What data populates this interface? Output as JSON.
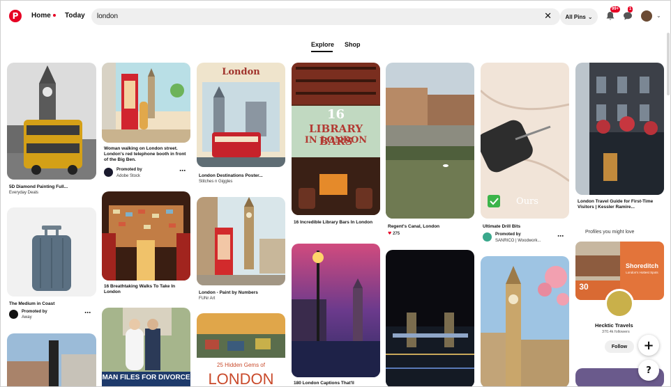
{
  "header": {
    "home_label": "Home",
    "today_label": "Today",
    "search_value": "london",
    "filter_label": "All Pins",
    "notifications_badge": "99+",
    "messages_badge": "1"
  },
  "tabs": {
    "explore": "Explore",
    "shop": "Shop"
  },
  "pins": {
    "p1": {
      "title": "5D Diamond Painting Full...",
      "source": "Everyday Deals"
    },
    "p2": {
      "title": "The Medium in Coast",
      "promoted": "Promoted by",
      "brand": "Away"
    },
    "p3": {
      "title": "Woman walking on London street. London's red telephone booth in front of the Big Ben.",
      "promoted": "Promoted by",
      "brand": "Adobe Stock"
    },
    "p4": {
      "title": "16 Breathtaking Walks To Take In London"
    },
    "p4b": {
      "overlay": "MAN FILES FOR DIVORCE"
    },
    "p5": {
      "overlay": "London",
      "title": "London Destinations Poster...",
      "source": "Stitches n Giggles"
    },
    "p6": {
      "title": "London - Paint by Numbers",
      "source": "FUNr Art"
    },
    "p6b": {
      "overlay_small": "25 Hidden Gems of",
      "overlay_big": "LONDON"
    },
    "p7": {
      "overlay_num": "16",
      "overlay_line1": "LIBRARY BARS",
      "overlay_line2": "IN LONDON",
      "title": "16 Incredible Library Bars In London"
    },
    "p8": {
      "title": "180 London Captions That'll"
    },
    "p9": {
      "title": "Regent's Canal, London",
      "reactions": "275"
    },
    "p11": {
      "overlay": "Ours",
      "title": "Ultimate Drill Bits",
      "promoted": "Promoted by",
      "brand": "SANRICO | Woodwork..."
    },
    "p13": {
      "title": "London Travel Guide for First-Time Visitors | Kessler Ramire..."
    }
  },
  "sidebar": {
    "heading": "Profiles you might love",
    "collage_text1": "Shoreditch",
    "collage_text2": "London's Hottest Spots",
    "collage_number": "30",
    "profile_name": "Hecktic Travels",
    "followers": "370.4k followers",
    "follow_label": "Follow"
  },
  "fab": {
    "plus": "+",
    "help": "?"
  },
  "colors": {
    "brand": "#e60023",
    "search_bg": "#efefef"
  }
}
